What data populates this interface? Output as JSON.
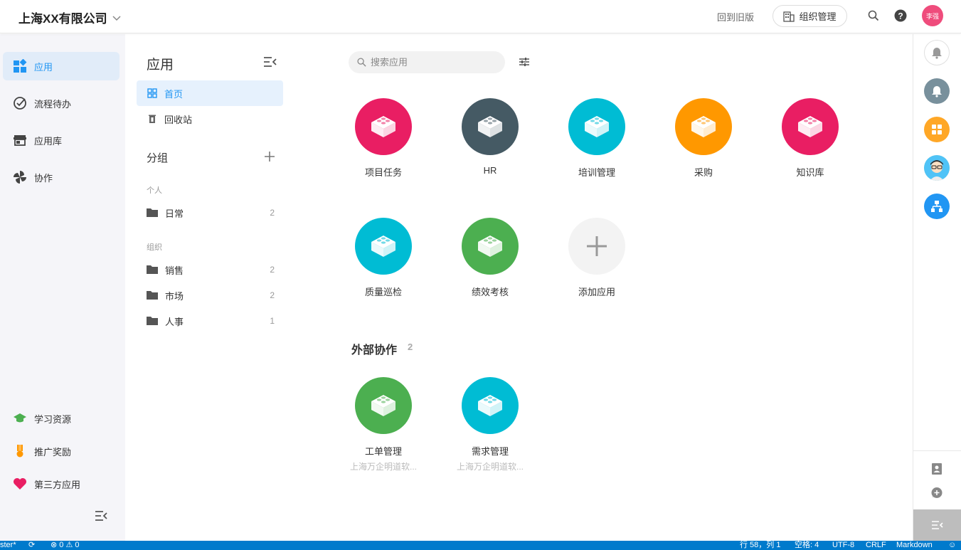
{
  "header": {
    "company": "上海XX有限公司",
    "back_old": "回到旧版",
    "org_manage": "组织管理",
    "avatar_text": "李强"
  },
  "leftnav": {
    "items": [
      {
        "label": "应用",
        "icon": "apps-icon"
      },
      {
        "label": "流程待办",
        "icon": "check-circle-icon"
      },
      {
        "label": "应用库",
        "icon": "store-icon"
      },
      {
        "label": "协作",
        "icon": "pinwheel-icon"
      }
    ],
    "bottom_items": [
      {
        "label": "学习资源",
        "icon": "graduation-cap-icon",
        "color": "#4caf50"
      },
      {
        "label": "推广奖励",
        "icon": "medal-icon",
        "color": "#ff9800"
      },
      {
        "label": "第三方应用",
        "icon": "heart-icon",
        "color": "#e91e63"
      }
    ]
  },
  "panel": {
    "title": "应用",
    "home": "首页",
    "recycle": "回收站",
    "group_title": "分组",
    "personal_label": "个人",
    "org_label": "组织",
    "personal_folders": [
      {
        "name": "日常",
        "count": "2"
      }
    ],
    "org_folders": [
      {
        "name": "销售",
        "count": "2"
      },
      {
        "name": "市场",
        "count": "2"
      },
      {
        "name": "人事",
        "count": "1"
      }
    ]
  },
  "main": {
    "search_placeholder": "搜索应用",
    "apps": [
      {
        "name": "项目任务",
        "color": "#e91e63"
      },
      {
        "name": "HR",
        "color": "#455a64"
      },
      {
        "name": "培训管理",
        "color": "#00bcd4"
      },
      {
        "name": "采购",
        "color": "#ff9800"
      },
      {
        "name": "知识库",
        "color": "#e91e63"
      },
      {
        "name": "质量巡检",
        "color": "#00bcd4"
      },
      {
        "name": "绩效考核",
        "color": "#4caf50"
      }
    ],
    "add_app": "添加应用",
    "external": {
      "title": "外部协作",
      "count": "2",
      "apps": [
        {
          "name": "工单管理",
          "sub": "上海万企明道软...",
          "color": "#4caf50"
        },
        {
          "name": "需求管理",
          "sub": "上海万企明道软...",
          "color": "#00bcd4"
        }
      ]
    }
  },
  "statusbar": {
    "branch": "ster*",
    "problems": "⊗ 0 ⚠ 0",
    "position": "行 58，列 1",
    "spaces": "空格: 4",
    "encoding": "UTF-8",
    "eol": "CRLF",
    "language": "Markdown"
  }
}
